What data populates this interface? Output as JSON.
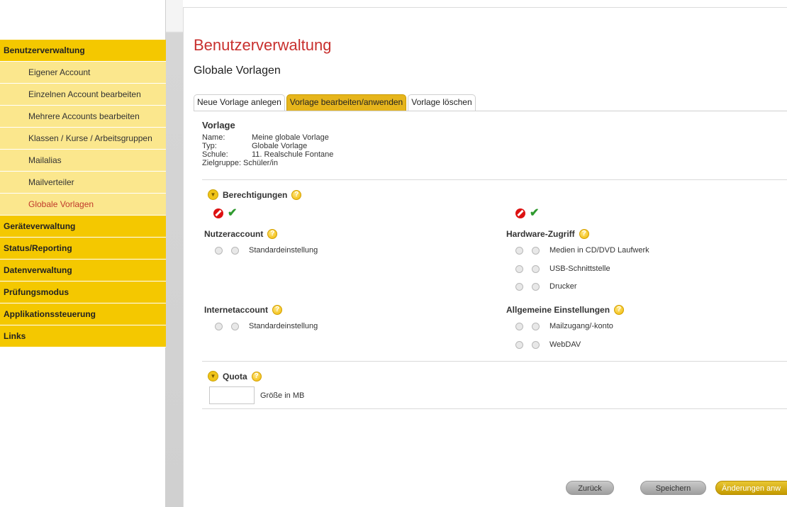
{
  "sidebar": {
    "items": [
      {
        "label": "Benutzerverwaltung"
      },
      {
        "label": "Eigener Account"
      },
      {
        "label": "Einzelnen Account bearbeiten"
      },
      {
        "label": "Mehrere Accounts bearbeiten"
      },
      {
        "label": "Klassen / Kurse / Arbeitsgruppen"
      },
      {
        "label": "Mailalias"
      },
      {
        "label": "Mailverteiler"
      },
      {
        "label": "Globale Vorlagen"
      },
      {
        "label": "Geräteverwaltung"
      },
      {
        "label": "Status/Reporting"
      },
      {
        "label": "Datenverwaltung"
      },
      {
        "label": "Prüfungsmodus"
      },
      {
        "label": "Applikationssteuerung"
      },
      {
        "label": "Links"
      }
    ]
  },
  "main": {
    "title": "Benutzerverwaltung",
    "subtitle": "Globale Vorlagen",
    "tabs": [
      {
        "label": "Neue Vorlage anlegen"
      },
      {
        "label": "Vorlage bearbeiten/anwenden"
      },
      {
        "label": "Vorlage löschen"
      }
    ],
    "vorlage": {
      "heading": "Vorlage",
      "rows": [
        {
          "key": "Name:",
          "value": "Meine globale Vorlage"
        },
        {
          "key": "Typ:",
          "value": "Globale Vorlage"
        },
        {
          "key": "Schule:",
          "value": "11. Realschule Fontane"
        },
        {
          "key": "Zielgruppe:",
          "value": "Schüler/in"
        }
      ]
    },
    "berechtigungen": {
      "label": "Berechtigungen",
      "nutzeraccount": {
        "title": "Nutzeraccount",
        "options": [
          "Standardeinstellung"
        ]
      },
      "internetaccount": {
        "title": "Internetaccount",
        "options": [
          "Standardeinstellung"
        ]
      },
      "hardware": {
        "title": "Hardware-Zugriff",
        "options": [
          "Medien in CD/DVD Laufwerk",
          "USB-Schnittstelle",
          "Drucker"
        ]
      },
      "allgemein": {
        "title": "Allgemeine Einstellungen",
        "options": [
          "Mailzugang/-konto",
          "WebDAV"
        ]
      }
    },
    "quota": {
      "label": "Quota",
      "input_value": "",
      "unit_label": "Größe in MB"
    },
    "buttons": {
      "back": "Zurück",
      "save": "Speichern",
      "apply": "Änderungen anw"
    }
  },
  "colors": {
    "accent": "#f4c800",
    "title_red": "#c8302e",
    "allow_green": "#2f9a2f",
    "deny_red": "#dd1111"
  }
}
